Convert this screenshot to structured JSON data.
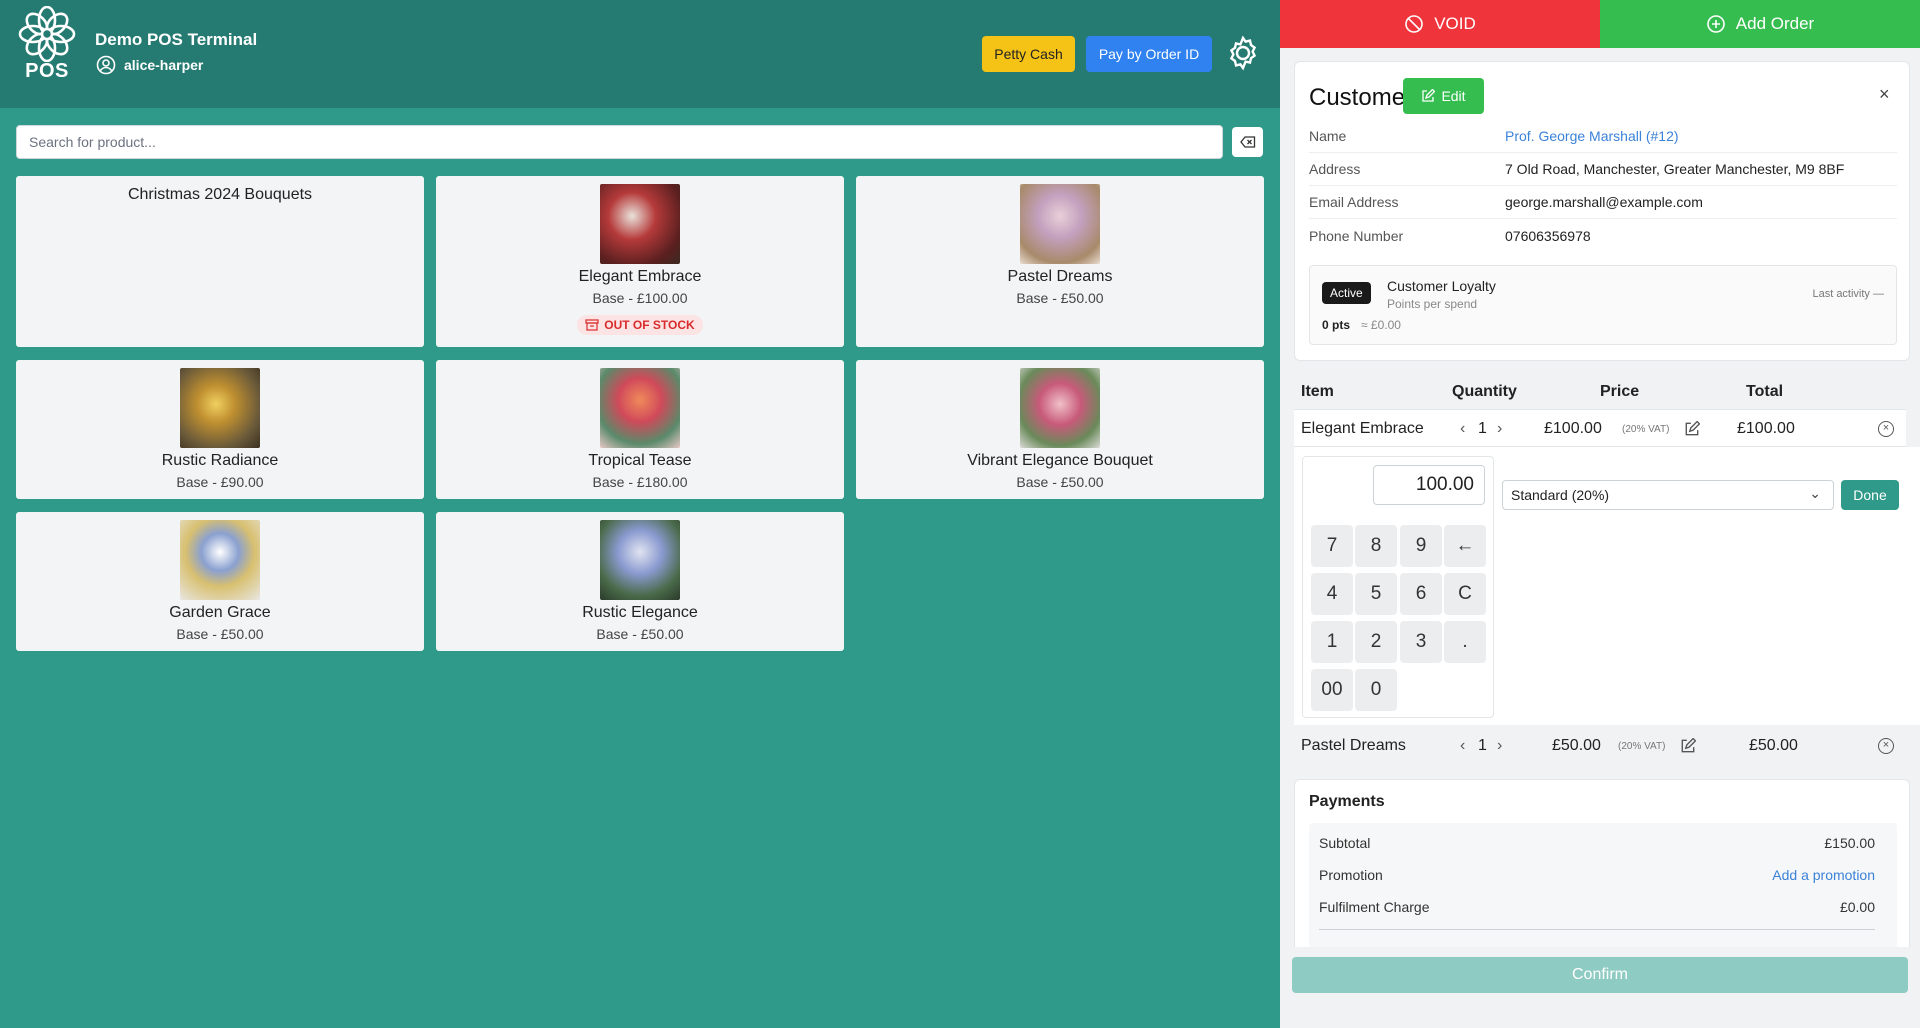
{
  "app": {
    "logo_text": "POS",
    "terminal_name": "Demo POS Terminal",
    "username": "alice-harper",
    "petty_cash_label": "Petty Cash",
    "pay_by_order_label": "Pay by Order ID"
  },
  "search": {
    "placeholder": "Search for product..."
  },
  "products": [
    {
      "type": "category",
      "name": "Christmas 2024 Bouquets"
    },
    {
      "name": "Elegant Embrace",
      "price": "Base - £100.00",
      "badge": "OUT OF STOCK",
      "thumb_color": "#7a2a2a"
    },
    {
      "name": "Pastel Dreams",
      "price": "Base - £50.00",
      "thumb_color": "#c8a6b8"
    },
    {
      "name": "Rustic Radiance",
      "price": "Base - £90.00",
      "thumb_color": "#9a7a3a"
    },
    {
      "name": "Tropical Tease",
      "price": "Base - £180.00",
      "thumb_color": "#d5584a"
    },
    {
      "name": "Vibrant Elegance Bouquet",
      "price": "Base - £50.00",
      "thumb_color": "#b86a7a"
    },
    {
      "name": "Garden Grace",
      "price": "Base - £50.00",
      "thumb_color": "#cfd3dc"
    },
    {
      "name": "Rustic Elegance",
      "price": "Base - £50.00",
      "thumb_color": "#6a7a9a"
    }
  ],
  "actions": {
    "void_label": "VOID",
    "add_order_label": "Add Order"
  },
  "customer": {
    "title": "Customer",
    "edit_label": "Edit",
    "close_glyph": "×",
    "fields": [
      {
        "label": "Name",
        "value": "Prof. George Marshall (#12)"
      },
      {
        "label": "Address",
        "value": "7 Old Road, Manchester, Greater Manchester, M9 8BF"
      },
      {
        "label": "Email Address",
        "value": "george.marshall@example.com"
      },
      {
        "label": "Phone Number",
        "value": "07606356978"
      }
    ],
    "loyalty": {
      "status": "Active",
      "title": "Customer Loyalty",
      "subtitle": "Points per spend",
      "last_activity": "Last activity —",
      "points": "0 pts",
      "points_value": "≈ £0.00"
    }
  },
  "items_table": {
    "headers": {
      "item": "Item",
      "quantity": "Quantity",
      "price": "Price",
      "total": "Total"
    },
    "rows": [
      {
        "name": "Elegant Embrace",
        "qty": "1",
        "price": "£100.00",
        "vat": "(20% VAT)",
        "total": "£100.00"
      },
      {
        "name": "Pastel Dreams",
        "qty": "1",
        "price": "£50.00",
        "vat": "(20% VAT)",
        "total": "£50.00"
      }
    ]
  },
  "editor": {
    "display_value": "100.00",
    "keys": [
      "7",
      "8",
      "9",
      "←",
      "4",
      "5",
      "6",
      "C",
      "1",
      "2",
      "3",
      ".",
      "00",
      "0"
    ],
    "vat_option": "Standard (20%)",
    "done_label": "Done"
  },
  "payments": {
    "title": "Payments",
    "rows": [
      {
        "label": "Subtotal",
        "value": "£150.00"
      },
      {
        "label": "Promotion",
        "value": "Add a promotion"
      },
      {
        "label": "Fulfilment Charge",
        "value": "£0.00"
      }
    ],
    "confirm_label": "Confirm"
  },
  "colors": {
    "background_teal": "#2f9a8a",
    "header_teal": "#257a71",
    "void_red": "#f0343b",
    "add_green": "#35be4f",
    "petty_yellow": "#f5c316",
    "pay_blue": "#2f82f0",
    "link_blue": "#3b82d9"
  }
}
